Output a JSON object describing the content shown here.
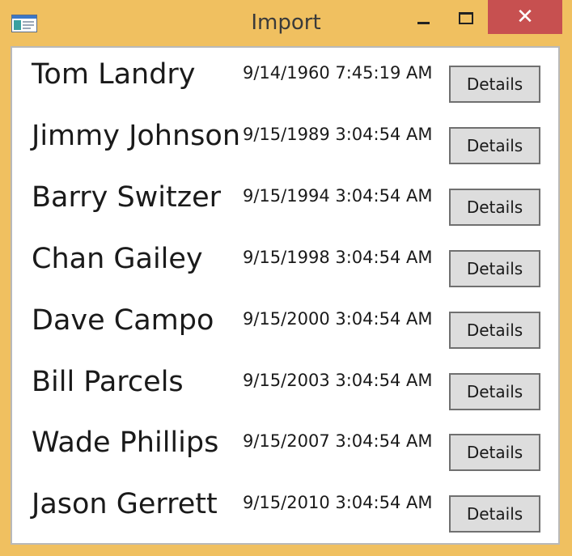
{
  "window": {
    "title": "Import",
    "close_glyph": "✕",
    "app_icon": "window-app-icon"
  },
  "colors": {
    "frame": "#f0c060",
    "close_button": "#c75050",
    "button_face": "#dddddd",
    "button_border": "#707070"
  },
  "rows": [
    {
      "name": "Tom Landry",
      "date": "9/14/1960 7:45:19 AM",
      "button": "Details"
    },
    {
      "name": "Jimmy Johnson",
      "date": "9/15/1989 3:04:54 AM",
      "button": "Details"
    },
    {
      "name": "Barry Switzer",
      "date": "9/15/1994 3:04:54 AM",
      "button": "Details"
    },
    {
      "name": "Chan Gailey",
      "date": "9/15/1998 3:04:54 AM",
      "button": "Details"
    },
    {
      "name": "Dave Campo",
      "date": "9/15/2000 3:04:54 AM",
      "button": "Details"
    },
    {
      "name": "Bill Parcels",
      "date": "9/15/2003 3:04:54 AM",
      "button": "Details"
    },
    {
      "name": "Wade Phillips",
      "date": "9/15/2007 3:04:54 AM",
      "button": "Details"
    },
    {
      "name": "Jason Gerrett",
      "date": "9/15/2010 3:04:54 AM",
      "button": "Details"
    }
  ]
}
